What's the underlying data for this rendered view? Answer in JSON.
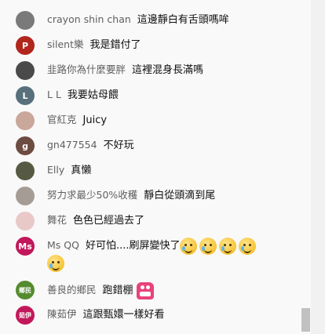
{
  "messages": [
    {
      "author": "crayon shin chan",
      "text": "這邊靜白有舌頭嗎哞",
      "avatar_color": "#7a7a7a",
      "avatar_initial": ""
    },
    {
      "author": "silent樂",
      "text": "我是錯付了",
      "avatar_color": "#b1261d",
      "avatar_initial": "P"
    },
    {
      "author": "韭路你為什麼要胖",
      "text": "這裡混身長滿嗎",
      "avatar_color": "#4b4a4a",
      "avatar_initial": ""
    },
    {
      "author": "L L",
      "text": "我要姑母餵",
      "avatar_color": "#57707c",
      "avatar_initial": "L"
    },
    {
      "author": "官紅克",
      "text": "Juicy",
      "avatar_color": "#c9a79a",
      "avatar_initial": ""
    },
    {
      "author": "gn477554",
      "text": "不好玩",
      "avatar_color": "#6d4c42",
      "avatar_initial": "g"
    },
    {
      "author": "Elly",
      "text": "真懶",
      "avatar_color": "#575a42",
      "avatar_initial": ""
    },
    {
      "author": "努力求最少50%收穫",
      "text": "靜白從頭滴到尾",
      "avatar_color": "#a59c96",
      "avatar_initial": ""
    },
    {
      "author": "舞花",
      "text": "色色已經過去了",
      "avatar_color": "#e9c8c8",
      "avatar_initial": ""
    },
    {
      "author": "Ms QQ",
      "text": "好可怕....刷屏變快了",
      "avatar_color": "#c2185b",
      "avatar_initial": "Ms"
    },
    {
      "author": "善良的鄉民",
      "text": "跑錯棚",
      "avatar_color": "#558b2f",
      "avatar_initial": "鄉民"
    },
    {
      "author": "陳茹伊",
      "text": "這跟甄嬛一樣好看",
      "avatar_color": "#c2185b",
      "avatar_initial": "茹伊"
    }
  ],
  "emojis": {
    "ms_qq_count": 5,
    "ms_qq_icon": "crying-smile-emoji",
    "monster_icon": "pink-monster-emoji"
  }
}
